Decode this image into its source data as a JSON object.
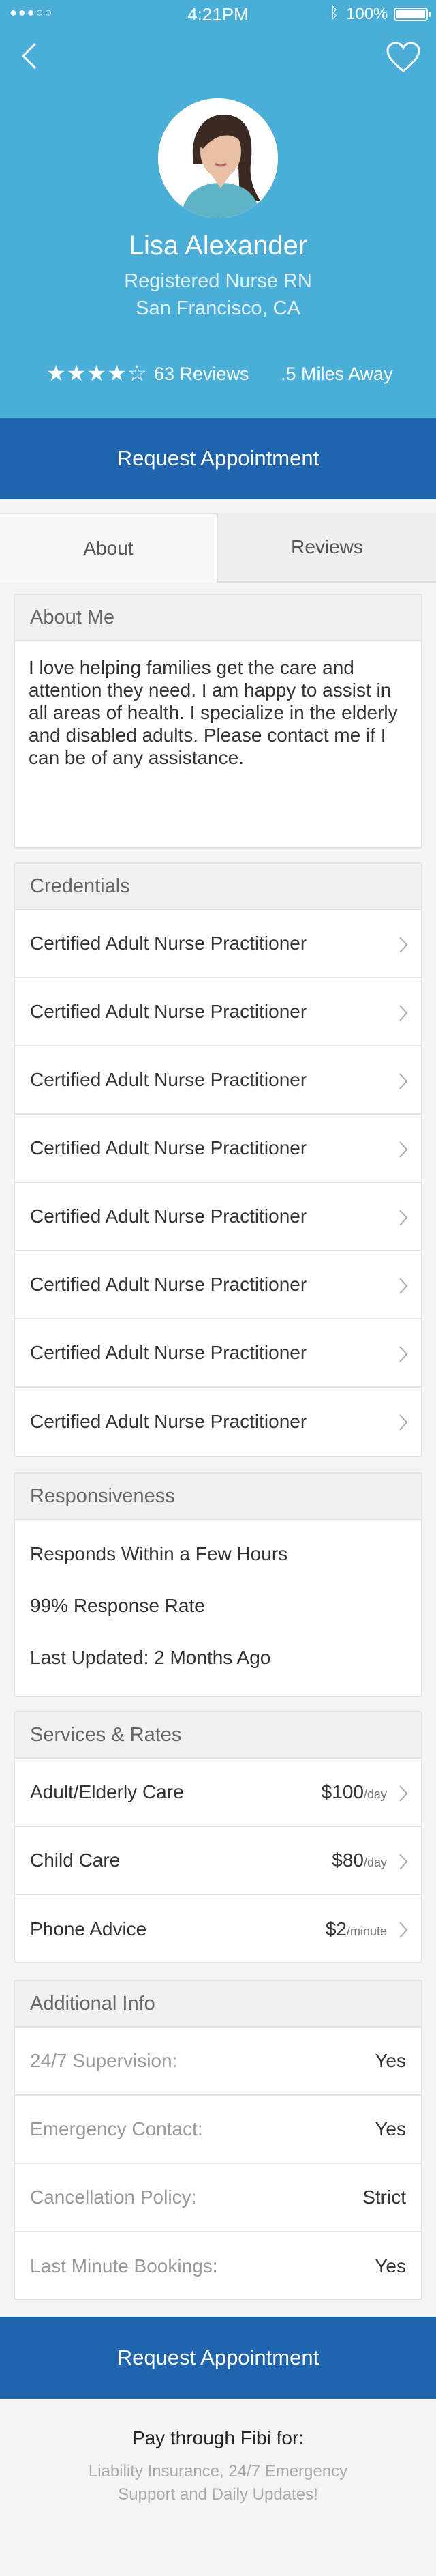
{
  "status_bar": {
    "signal": "●●●○○",
    "time": "4:21PM",
    "bluetooth": "ᛒ",
    "battery": "100%"
  },
  "colors": {
    "hero": "#4aaed9",
    "cta": "#1f64ac"
  },
  "icons": {
    "back": "chevron-left-icon",
    "favorite": "heart-icon",
    "row": "chevron-right-icon"
  },
  "profile": {
    "name": "Lisa Alexander",
    "title": "Registered Nurse RN",
    "location": "San Francisco, CA",
    "rating": 4,
    "stars": "★★★★☆",
    "reviews": "63 Reviews",
    "distance": ".5 Miles Away"
  },
  "cta_label": "Request Appointment",
  "tabs": {
    "about": "About",
    "reviews": "Reviews"
  },
  "about": {
    "header": "About Me",
    "text": "I love helping families get the care and attention they need. I am happy to assist in all areas of health. I specialize in the elderly and disabled adults. Please contact me if I can be of any assistance."
  },
  "credentials": {
    "header": "Credentials",
    "items": [
      "Certified Adult Nurse Practitioner",
      "Certified Adult Nurse Practitioner",
      "Certified Adult Nurse Practitioner",
      "Certified Adult Nurse Practitioner",
      "Certified Adult Nurse Practitioner",
      "Certified Adult Nurse Practitioner",
      "Certified Adult Nurse Practitioner",
      "Certified Adult Nurse Practitioner"
    ]
  },
  "responsiveness": {
    "header": "Responsiveness",
    "items": [
      "Responds Within a Few Hours",
      "99% Response Rate",
      "Last Updated: 2 Months Ago"
    ]
  },
  "services": {
    "header": "Services & Rates",
    "items": [
      {
        "name": "Adult/Elderly Care",
        "price": "$100",
        "unit": "/day"
      },
      {
        "name": "Child Care",
        "price": "$80",
        "unit": "/day"
      },
      {
        "name": "Phone Advice",
        "price": "$2",
        "unit": "/minute"
      }
    ]
  },
  "additional": {
    "header": "Additional Info",
    "items": [
      {
        "label": "24/7 Supervision:",
        "value": "Yes"
      },
      {
        "label": "Emergency Contact:",
        "value": "Yes"
      },
      {
        "label": "Cancellation Policy:",
        "value": "Strict"
      },
      {
        "label": "Last Minute Bookings:",
        "value": "Yes"
      }
    ]
  },
  "footer": {
    "title": "Pay through Fibi for:",
    "text": "Liability Insurance, 24/7 Emergency Support and Daily Updates!"
  }
}
